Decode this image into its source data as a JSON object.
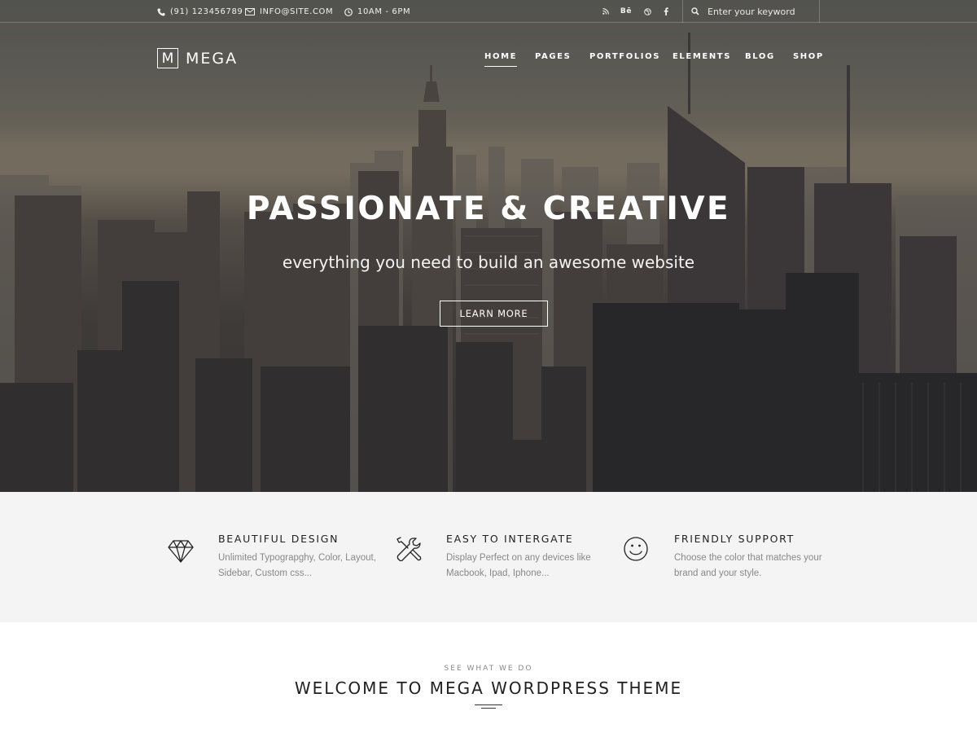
{
  "topbar": {
    "phone": "(91) 123456789",
    "email": "INFO@SITE.COM",
    "hours": "10AM - 6PM",
    "social": [
      "rss-icon",
      "behance-icon",
      "dribbble-icon",
      "facebook-icon"
    ],
    "behance_label": "Bē",
    "search_placeholder": "Enter your keyword"
  },
  "brand": {
    "mark": "M",
    "name": "MEGA"
  },
  "nav": {
    "items": [
      "HOME",
      "PAGES",
      "PORTFOLIOS",
      "ELEMENTS",
      "BLOG",
      "SHOP"
    ],
    "active": "HOME"
  },
  "hero": {
    "title": "PASSIONATE & CREATIVE",
    "subtitle": "everything you need to build an awesome website",
    "button": "LEARN MORE"
  },
  "features": [
    {
      "icon": "diamond-icon",
      "title": "BEAUTIFUL DESIGN",
      "desc": "Unlimited Typograpghy, Color, Layout, Sidebar, Custom css..."
    },
    {
      "icon": "tools-icon",
      "title": "EASY TO INTERGATE",
      "desc": "Display Perfect on any devices like Macbook, Ipad, Iphone..."
    },
    {
      "icon": "smiley-icon",
      "title": "FRIENDLY SUPPORT",
      "desc": "Choose the color that matches your brand and your style."
    }
  ],
  "section": {
    "kicker": "SEE WHAT WE DO",
    "title": "WELCOME TO MEGA WORDPRESS THEME"
  },
  "colors": {
    "feature_bg": "#f4f4f4",
    "text_dark": "#222222",
    "text_muted": "#888888"
  }
}
